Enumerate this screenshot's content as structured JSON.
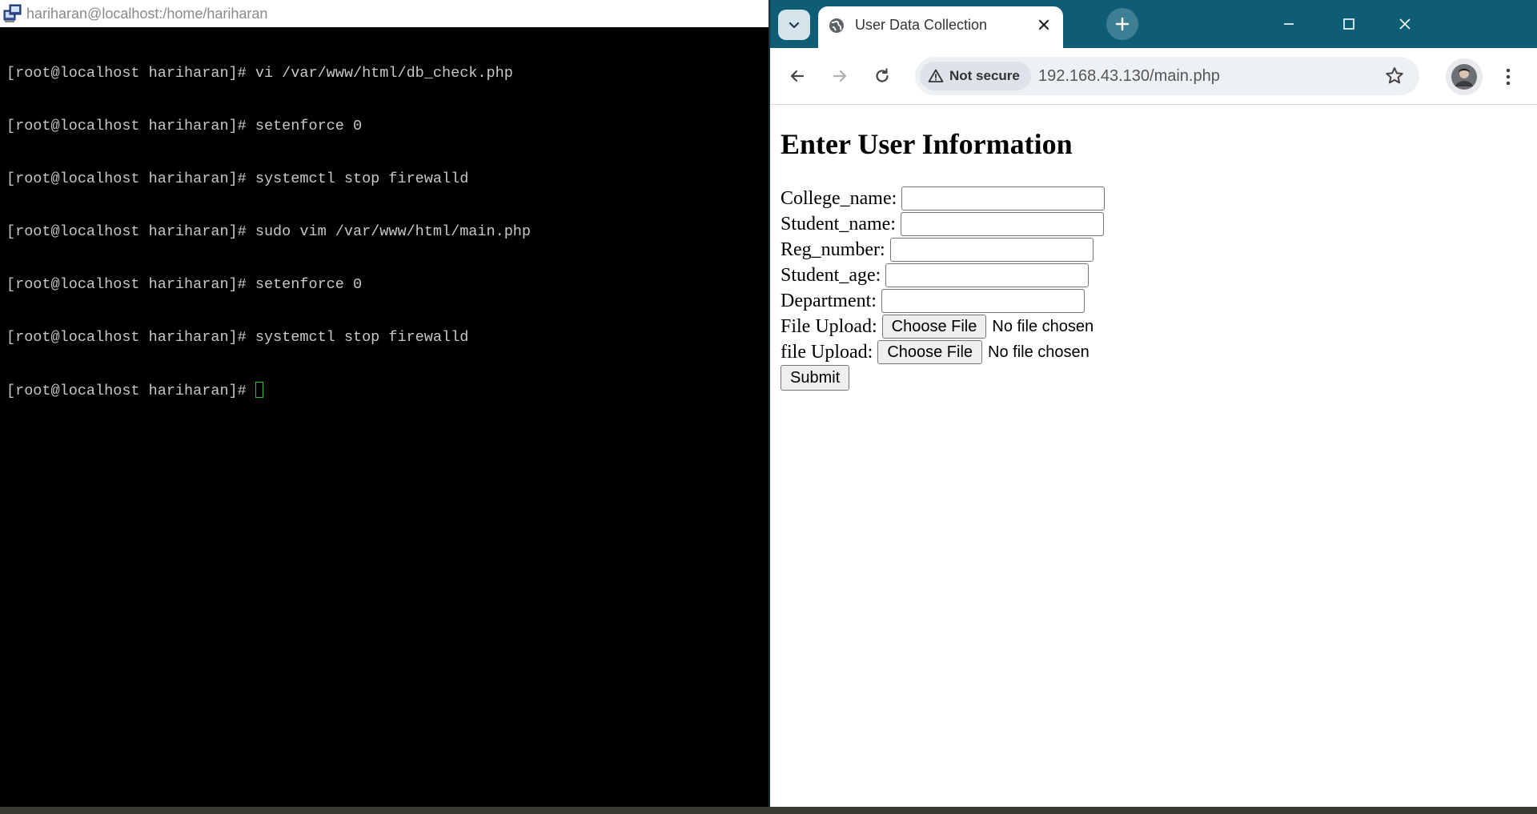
{
  "terminal": {
    "title": "hariharan@localhost:/home/hariharan",
    "lines": [
      "[root@localhost hariharan]# vi /var/www/html/db_check.php",
      "[root@localhost hariharan]# setenforce 0",
      "[root@localhost hariharan]# systemctl stop firewalld",
      "[root@localhost hariharan]# sudo vim /var/www/html/main.php",
      "[root@localhost hariharan]# setenforce 0",
      "[root@localhost hariharan]# systemctl stop firewalld"
    ],
    "prompt": "[root@localhost hariharan]# ",
    "colors": {
      "background": "#000000",
      "text": "#c7c7c7",
      "cursor": "#2ec32e"
    }
  },
  "browser": {
    "tab_title": "User Data Collection",
    "security_label": "Not secure",
    "url": "192.168.43.130/main.php",
    "colors": {
      "tabbar": "#0f5c77"
    },
    "icons": [
      "tab-search-icon",
      "globe-icon",
      "close-icon",
      "plus-icon",
      "minimize-icon",
      "maximize-icon",
      "window-close-icon",
      "back-icon",
      "forward-icon",
      "reload-icon",
      "warning-icon",
      "star-icon",
      "avatar",
      "kebab-menu-icon"
    ]
  },
  "page": {
    "heading": "Enter User Information",
    "fields": [
      {
        "label": "College_name:",
        "value": ""
      },
      {
        "label": "Student_name:",
        "value": ""
      },
      {
        "label": "Reg_number:",
        "value": ""
      },
      {
        "label": "Student_age:",
        "value": ""
      },
      {
        "label": "Department:",
        "value": ""
      }
    ],
    "file_fields": [
      {
        "label": "File Upload:",
        "button": "Choose File",
        "status": "No file chosen"
      },
      {
        "label": "file Upload:",
        "button": "Choose File",
        "status": "No file chosen"
      }
    ],
    "submit_label": "Submit"
  }
}
